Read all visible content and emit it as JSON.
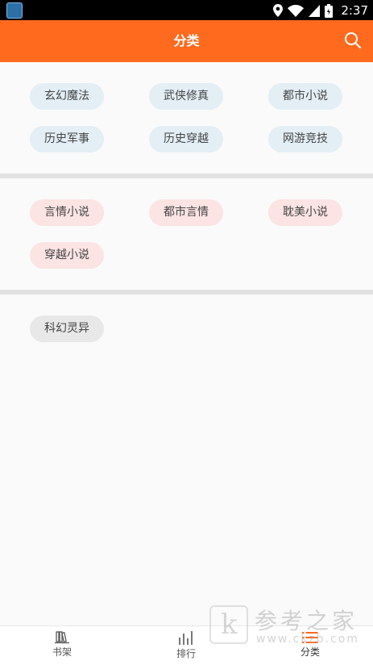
{
  "status_bar": {
    "time": "2:37",
    "icons": [
      "app-icon",
      "location-icon",
      "wifi-icon",
      "signal-icon",
      "battery-icon"
    ]
  },
  "app_bar": {
    "title": "分类",
    "search_icon": "search-icon",
    "color": "#ff6a1e"
  },
  "sections": [
    {
      "name": "male",
      "color": "#e3eef5",
      "tags": [
        "玄幻魔法",
        "武侠修真",
        "都市小说",
        "历史军事",
        "历史穿越",
        "网游竞技"
      ]
    },
    {
      "name": "female",
      "color": "#fbe4e3",
      "tags": [
        "言情小说",
        "都市言情",
        "耽美小说",
        "穿越小说"
      ]
    },
    {
      "name": "other",
      "color": "#e8e8e8",
      "tags": [
        "科幻灵异"
      ]
    }
  ],
  "bottom_nav": {
    "items": [
      {
        "label": "书架",
        "icon": "bookshelf-icon"
      },
      {
        "label": "排行",
        "icon": "ranking-icon"
      },
      {
        "label": "分类",
        "icon": "category-icon",
        "active": true
      }
    ]
  },
  "watermark": {
    "text": "参考之家",
    "url": "www.ckzb.com"
  }
}
